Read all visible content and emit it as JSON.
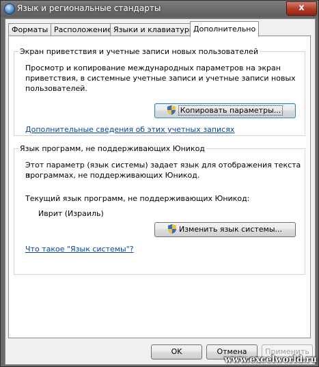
{
  "window": {
    "title": "Язык и региональные стандарты",
    "close_label": "x"
  },
  "tabs": [
    {
      "label": "Форматы",
      "active": false
    },
    {
      "label": "Расположение",
      "active": false
    },
    {
      "label": "Языки и клавиатуры",
      "active": false
    },
    {
      "label": "Дополнительно",
      "active": true
    }
  ],
  "welcome_group": {
    "title": "Экран приветствия и учетные записи новых пользователей",
    "description_line1": "Просмотр и копирование международных параметров на экран",
    "description_line2": "приветствия, в системные учетные записи и учетные записи новых",
    "description_line3": "пользователей.",
    "copy_button": "Копировать параметры...",
    "more_info_link": "Дополнительные сведения об этих учетных записях"
  },
  "nonunicode_group": {
    "title": "Язык программ, не поддерживающих Юникод",
    "description_line1": "Этот параметр (язык системы) задает язык для отображения текста в",
    "description_line2": "программах, не поддерживающих Юникод.",
    "current_label": "Текущий язык программ, не поддерживающих Юникод:",
    "current_value": "Иврит (Израиль)",
    "change_button": "Изменить язык системы...",
    "what_is_link": "Что такое \"Язык системы\"?"
  },
  "footer": {
    "ok": "OK",
    "cancel": "Отмена",
    "apply": "Применить"
  },
  "watermark": "www.excelworld.ru"
}
